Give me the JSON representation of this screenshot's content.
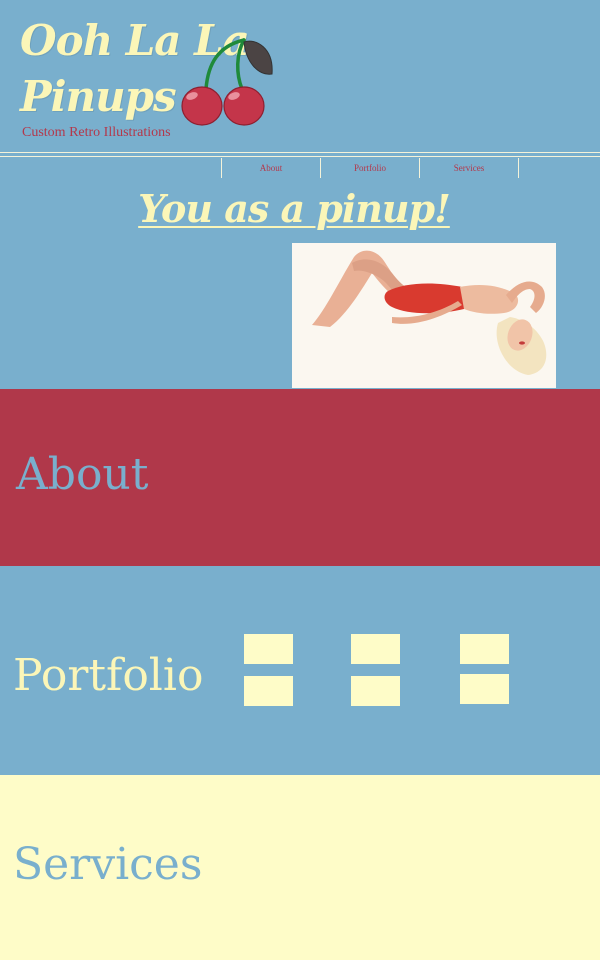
{
  "header": {
    "logo_line1": "Ooh La La",
    "logo_line2": "Pinups",
    "tagline": "Custom Retro Illustrations"
  },
  "nav": {
    "items": [
      {
        "label": "About"
      },
      {
        "label": "Portfolio"
      },
      {
        "label": "Services"
      }
    ]
  },
  "hero": {
    "title": "You as a pinup!"
  },
  "sections": {
    "about": {
      "heading": "About"
    },
    "portfolio": {
      "heading": "Portfolio",
      "thumbnail_count": 6
    },
    "services": {
      "heading": "Services"
    }
  },
  "colors": {
    "background_blue": "#79afcd",
    "cream": "#fbf6b8",
    "cherry_red": "#b0384a",
    "services_cream": "#fefcc8"
  }
}
